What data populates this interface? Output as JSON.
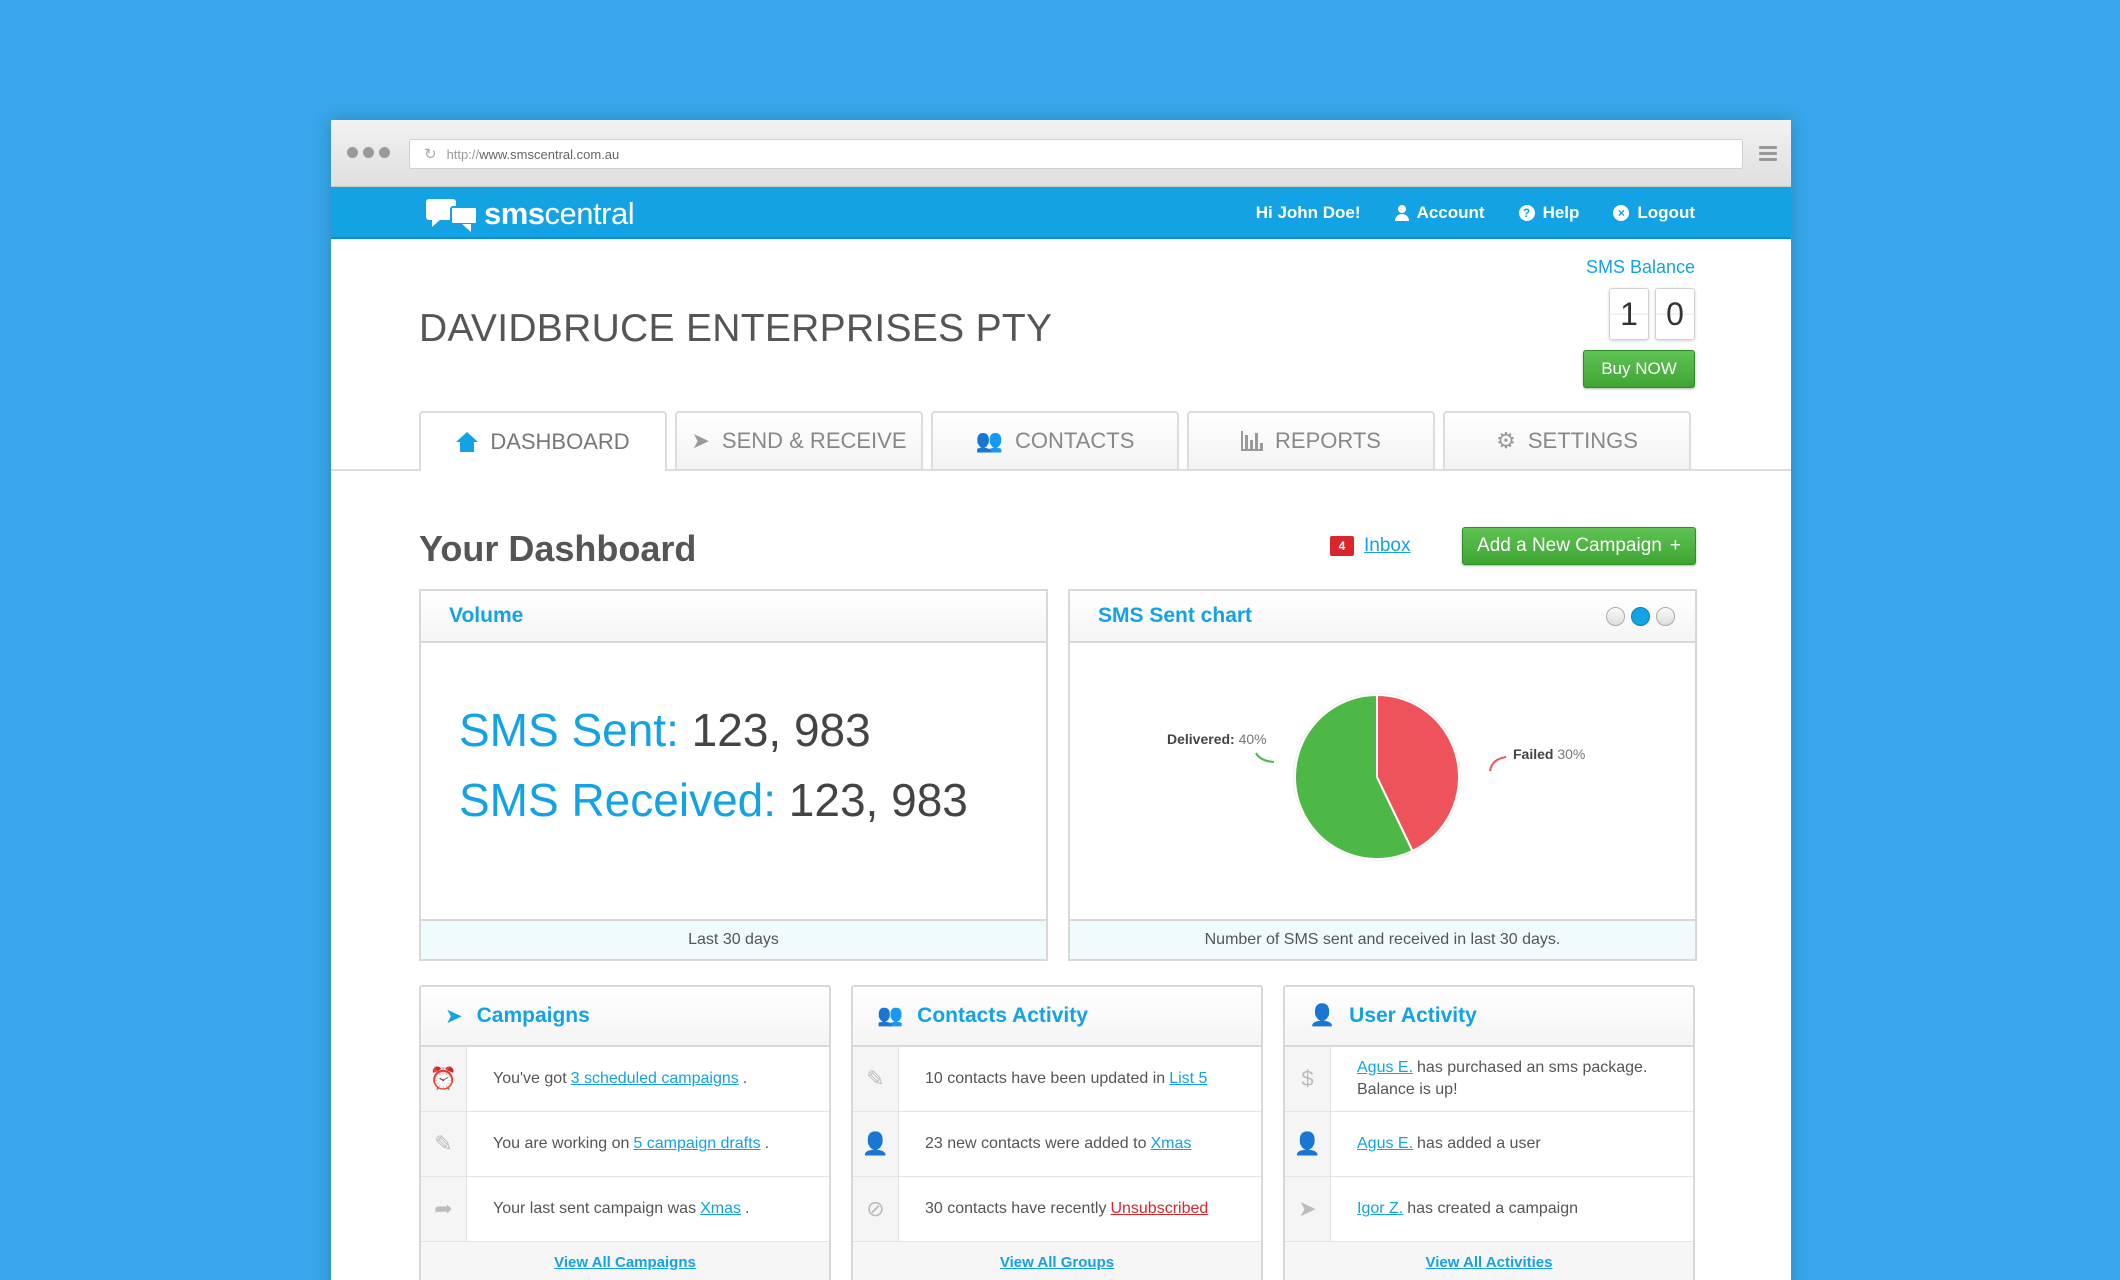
{
  "browser": {
    "url_protocol": "http://",
    "url_host": "www.smscentral.com.au"
  },
  "brand": {
    "logo_bold": "sms",
    "logo_rest": "central"
  },
  "nav": {
    "greeting": "Hi John Doe!",
    "account": "Account",
    "help": "Help",
    "help_icon": "?",
    "logout": "Logout",
    "logout_icon": "×"
  },
  "company": "DAVIDBRUCE ENTERPRISES PTY",
  "balance": {
    "label": "SMS Balance",
    "digits": [
      "1",
      "0"
    ],
    "buy_label": "Buy NOW"
  },
  "tabs": [
    {
      "label": "DASHBOARD",
      "icon": "home-icon"
    },
    {
      "label": "SEND & RECEIVE",
      "icon": "paper-plane-icon"
    },
    {
      "label": "CONTACTS",
      "icon": "users-icon"
    },
    {
      "label": "REPORTS",
      "icon": "bar-chart-icon"
    },
    {
      "label": "SETTINGS",
      "icon": "gear-icon"
    }
  ],
  "dashboard": {
    "title": "Your Dashboard",
    "inbox_label": "Inbox",
    "inbox_count": "4",
    "add_campaign": "Add a New Campaign",
    "add_icon": "+"
  },
  "volume": {
    "title": "Volume",
    "sent_label": "SMS Sent:",
    "sent_value": "123, 983",
    "received_label": "SMS Received:",
    "received_value": "123, 983",
    "footer": "Last 30 days"
  },
  "sms_chart": {
    "title": "SMS Sent chart",
    "footer": "Number of SMS sent and received in last 30 days.",
    "delivered_label": "Delivered:",
    "delivered_pct": "40%",
    "failed_label": "Failed",
    "failed_pct": "30%",
    "colors": {
      "delivered": "#4eb847",
      "failed": "#ee525a"
    }
  },
  "chart_data": {
    "type": "pie",
    "categories": [
      "Delivered",
      "Failed"
    ],
    "values": [
      40,
      30
    ],
    "title": "SMS Sent chart"
  },
  "campaigns": {
    "title": "Campaigns",
    "rows": [
      {
        "icon": "alarm-clock-icon",
        "pre": "You've got",
        "link": "3 scheduled campaigns",
        "post": "."
      },
      {
        "icon": "pencil-icon",
        "pre": "You are working on",
        "link": "5 campaign drafts",
        "post": "."
      },
      {
        "icon": "share-arrow-icon",
        "pre": "Your last sent campaign was",
        "link": "Xmas",
        "post": "."
      }
    ],
    "footer": "View All Campaigns"
  },
  "contacts_activity": {
    "title": "Contacts Activity",
    "rows": [
      {
        "icon": "pencil-icon",
        "pre": "10 contacts have been updated in",
        "link": "List 5",
        "post": ""
      },
      {
        "icon": "add-user-icon",
        "pre": "23 new contacts were added to",
        "link": "Xmas",
        "post": ""
      },
      {
        "icon": "block-icon",
        "pre": "30 contacts have recently",
        "link": "Unsubscribed",
        "post": ""
      }
    ],
    "footer": "View All Groups"
  },
  "user_activity": {
    "title": "User Activity",
    "rows": [
      {
        "icon": "dollar-icon",
        "link": "Agus E.",
        "post": "has purchased an sms package.",
        "post2": "Balance is up!"
      },
      {
        "icon": "add-user-icon",
        "link": "Agus E.",
        "post": "has added a user",
        "post2": ""
      },
      {
        "icon": "paper-plane-icon",
        "link": "Igor Z.",
        "post": "has created a campaign",
        "post2": ""
      }
    ],
    "footer": "View All Activities"
  }
}
